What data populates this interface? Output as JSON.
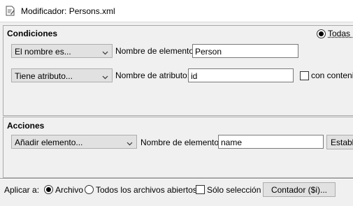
{
  "window": {
    "title": "Modificador: Persons.xml",
    "icon": "document-edit-icon"
  },
  "conditions": {
    "title": "Condiciones",
    "match_option": "Todas l",
    "row1": {
      "combo_value": "El nombre es...",
      "field_label": "Nombre de elemento:",
      "field_value": "Person"
    },
    "row2": {
      "combo_value": "Tiene atributo...",
      "field_label": "Nombre de atributo:",
      "field_value": "id",
      "checkbox_label": "con contenid"
    }
  },
  "actions": {
    "title": "Acciones",
    "row1": {
      "combo_value": "Añadir elemento...",
      "field_label": "Nombre de elemento:",
      "field_value": "name",
      "button_label": "Establ"
    }
  },
  "footer": {
    "apply_label": "Aplicar a:",
    "option_file": "Archivo",
    "option_all": "Todos los archivos abiertos",
    "selection_only": "Sólo selección",
    "counter_button": "Contador ($i)..."
  }
}
